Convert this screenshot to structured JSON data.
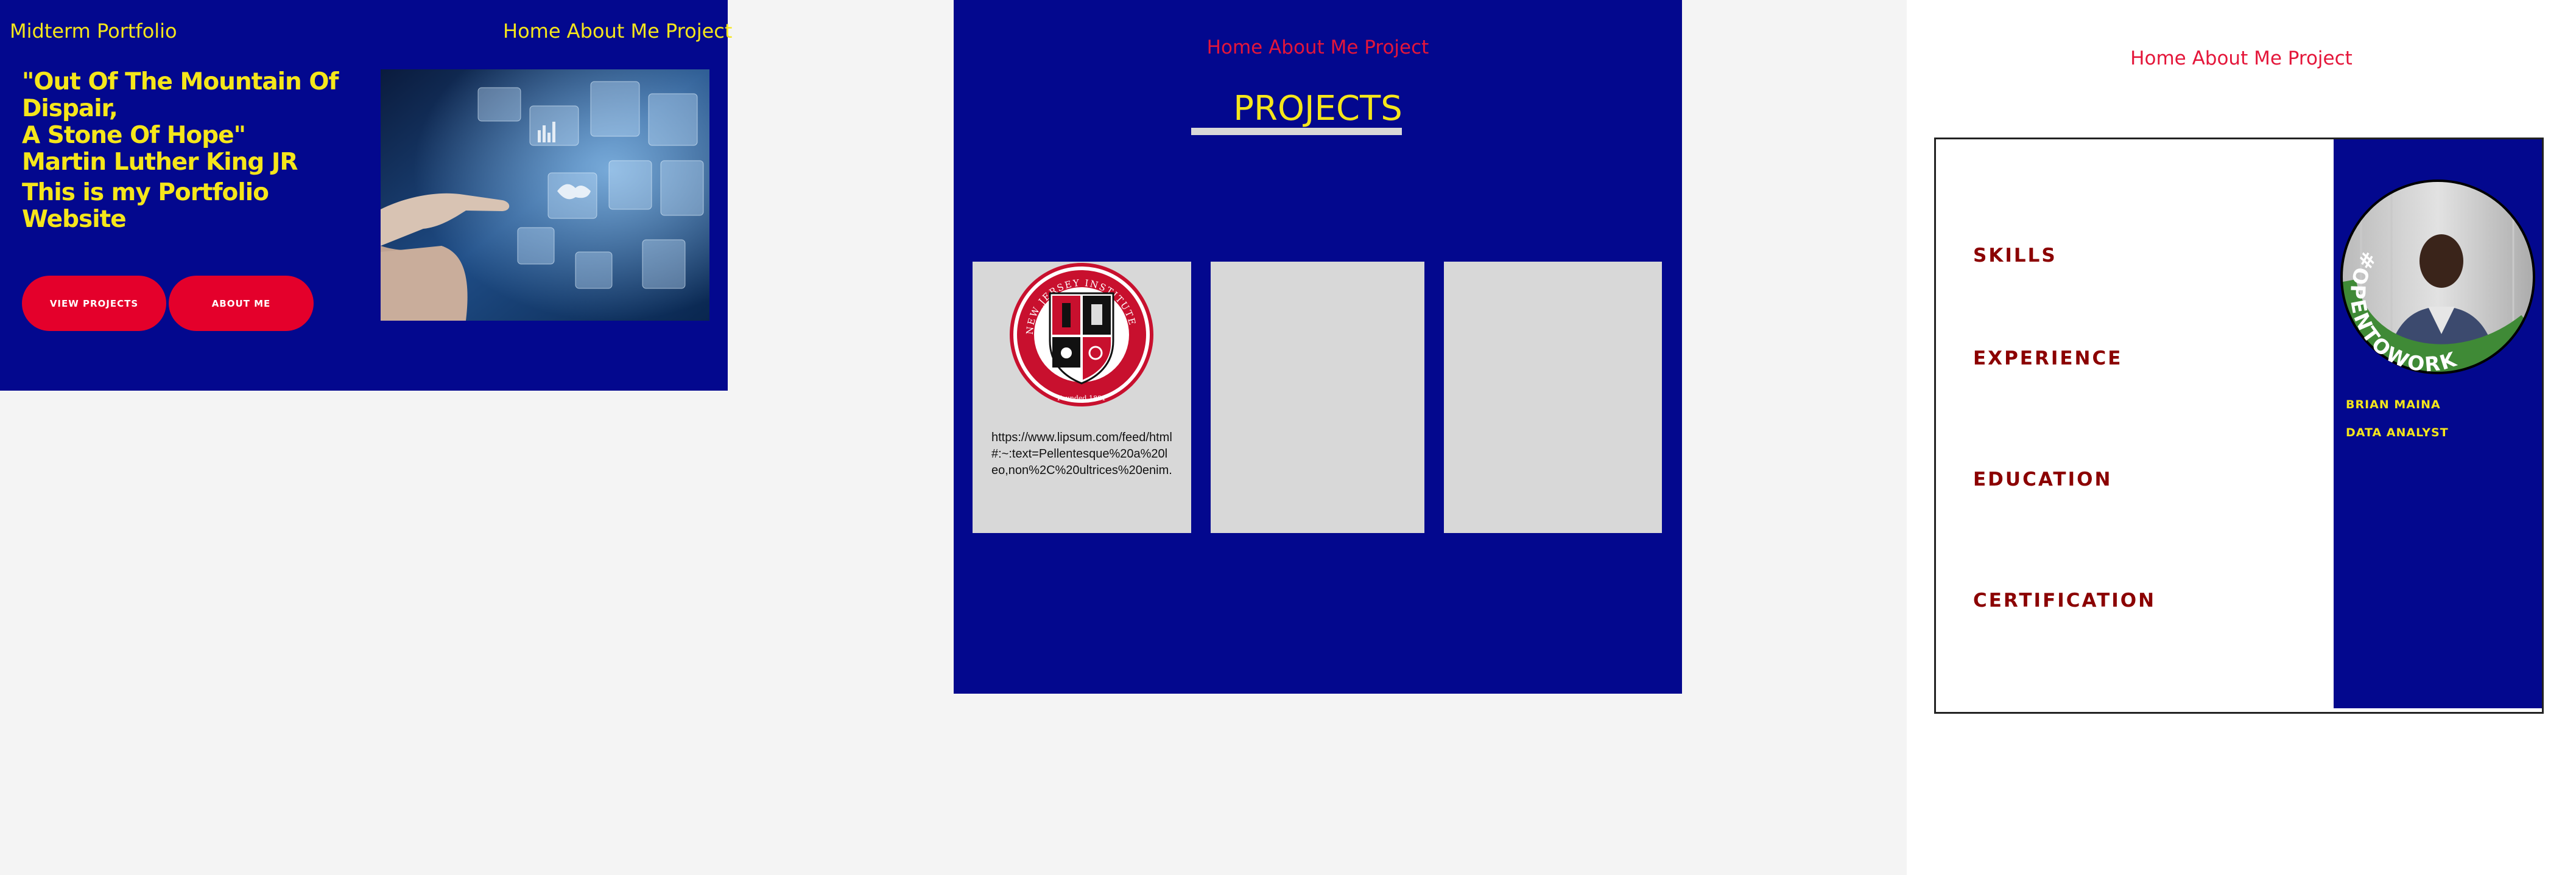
{
  "home": {
    "brand": "Midterm Portfolio",
    "nav": "Home About Me Project",
    "quote_line1": "\"Out Of The Mountain Of Dispair,",
    "quote_line2": "A Stone Of Hope\"",
    "quote_line3": "Martin Luther King JR",
    "quote_line4": "This is my Portfolio Website",
    "btn_projects": "VIEW PROJECTS",
    "btn_about": "ABOUT ME"
  },
  "projects": {
    "nav": "Home About Me Project",
    "title": "PROJECTS",
    "card1_url": "https://www.lipsum.com/feed/html#:~:text=Pellentesque%20a%20leo,non%2C%20ultrices%20enim.",
    "seal_text": "NEW JERSEY INSTITUTE OF TECHNOLOGY",
    "seal_founded": "Founded 1881"
  },
  "about": {
    "nav": "Home About Me Project",
    "sections": [
      "SKILLS",
      "EXPERIENCE",
      "EDUCATION",
      "CERTIFICATION"
    ],
    "badge": "#OPENTOWORK",
    "name": "BRIAN MAINA",
    "role": "DATA ANALYST"
  },
  "colors": {
    "navy": "#03088e",
    "yellow": "#f5e61b",
    "red": "#e4002b",
    "dark_red": "#8b0000",
    "card_gray": "#d8d8d8"
  }
}
